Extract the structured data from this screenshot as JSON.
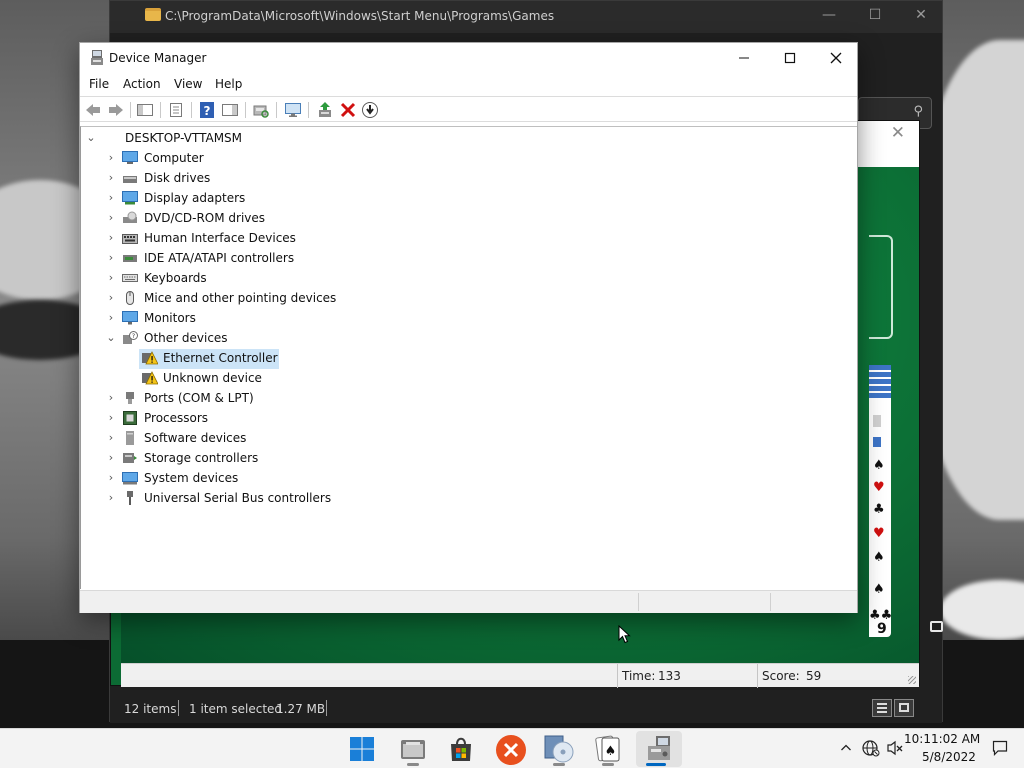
{
  "explorer": {
    "path": "C:\\ProgramData\\Microsoft\\Windows\\Start Menu\\Programs\\Games",
    "status": {
      "items": "12 items",
      "selected": "1 item selected",
      "size": "1.27 MB"
    }
  },
  "solitaire": {
    "close_glyph": "✕",
    "card_rank": "9",
    "time_label": "Time:",
    "time_value": "133",
    "score_label": "Score:",
    "score_value": "59"
  },
  "device_manager": {
    "title": "Device Manager",
    "window_controls": {
      "minimize": "—",
      "maximize": "☐",
      "close": "✕"
    },
    "menus": [
      "File",
      "Action",
      "View",
      "Help"
    ],
    "toolbar": [
      "back-arrow-icon",
      "forward-arrow-icon",
      "show-hide-console-tree-icon",
      "properties-icon",
      "help-icon",
      "action-pane-icon",
      "scan-hardware-icon",
      "monitor-icon",
      "update-driver-icon",
      "uninstall-icon",
      "disable-device-icon"
    ],
    "tree": {
      "root": "DESKTOP-VTTAMSM",
      "categories": [
        {
          "label": "Computer",
          "icon": "computer-icon",
          "expanded": false
        },
        {
          "label": "Disk drives",
          "icon": "disk-drive-icon",
          "expanded": false
        },
        {
          "label": "Display adapters",
          "icon": "display-adapter-icon",
          "expanded": false
        },
        {
          "label": "DVD/CD-ROM drives",
          "icon": "dvd-drive-icon",
          "expanded": false
        },
        {
          "label": "Human Interface Devices",
          "icon": "hid-icon",
          "expanded": false
        },
        {
          "label": "IDE ATA/ATAPI controllers",
          "icon": "ide-controller-icon",
          "expanded": false
        },
        {
          "label": "Keyboards",
          "icon": "keyboard-icon",
          "expanded": false
        },
        {
          "label": "Mice and other pointing devices",
          "icon": "mouse-icon",
          "expanded": false
        },
        {
          "label": "Monitors",
          "icon": "monitor-icon",
          "expanded": false
        },
        {
          "label": "Other devices",
          "icon": "unknown-device-category-icon",
          "expanded": true,
          "children": [
            {
              "label": "Ethernet Controller",
              "icon": "warning-device-icon",
              "selected": true
            },
            {
              "label": "Unknown device",
              "icon": "warning-device-icon",
              "selected": false
            }
          ]
        },
        {
          "label": "Ports (COM & LPT)",
          "icon": "port-icon",
          "expanded": false
        },
        {
          "label": "Processors",
          "icon": "processor-icon",
          "expanded": false
        },
        {
          "label": "Software devices",
          "icon": "software-device-icon",
          "expanded": false
        },
        {
          "label": "Storage controllers",
          "icon": "storage-controller-icon",
          "expanded": false
        },
        {
          "label": "System devices",
          "icon": "system-device-icon",
          "expanded": false
        },
        {
          "label": "Universal Serial Bus controllers",
          "icon": "usb-icon",
          "expanded": false
        }
      ]
    }
  },
  "taskbar": {
    "apps": [
      {
        "name": "start",
        "icon": "windows-start-icon",
        "active": false
      },
      {
        "name": "file-explorer",
        "icon": "file-explorer-icon",
        "active": false
      },
      {
        "name": "store",
        "icon": "store-bag-icon",
        "active": false
      },
      {
        "name": "app-x",
        "icon": "orange-x-icon",
        "active": false
      },
      {
        "name": "media",
        "icon": "cd-media-icon",
        "active": false
      },
      {
        "name": "solitaire",
        "icon": "playing-cards-icon",
        "active": false
      },
      {
        "name": "device-manager",
        "icon": "device-manager-icon",
        "active": true
      }
    ],
    "tray": {
      "icons": [
        "chevron-up-icon",
        "globe-network-icon",
        "speaker-muted-icon"
      ],
      "time": "10:11:02 AM",
      "date": "5/8/2022"
    }
  },
  "colors": {
    "selection": "#cce4f7",
    "felt": "#0c6b34",
    "taskbar_accent": "#0067c0",
    "uninstall_red": "#d01010",
    "warning_yellow": "#f5c518"
  }
}
